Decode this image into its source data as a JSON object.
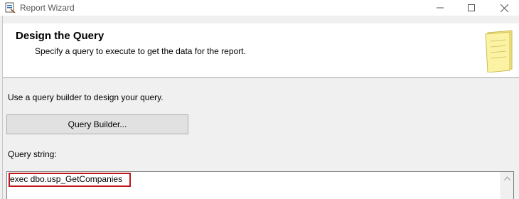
{
  "window": {
    "title": "Report Wizard",
    "icon": "report-wizard-icon",
    "controls": [
      "minimize-icon",
      "maximize-icon",
      "close-icon"
    ]
  },
  "header": {
    "title": "Design the Query",
    "subtitle": "Specify a query to execute to get the data for the report.",
    "icon": "notepad-icon"
  },
  "body": {
    "instructions": "Use a query builder to design your query.",
    "query_builder_label": "Query Builder...",
    "query_string_label": "Query string:",
    "query_string_value": "exec dbo.usp_GetCompanies"
  },
  "colors": {
    "highlight": "#c0141c",
    "note_yellow": "#fbf3a3"
  }
}
